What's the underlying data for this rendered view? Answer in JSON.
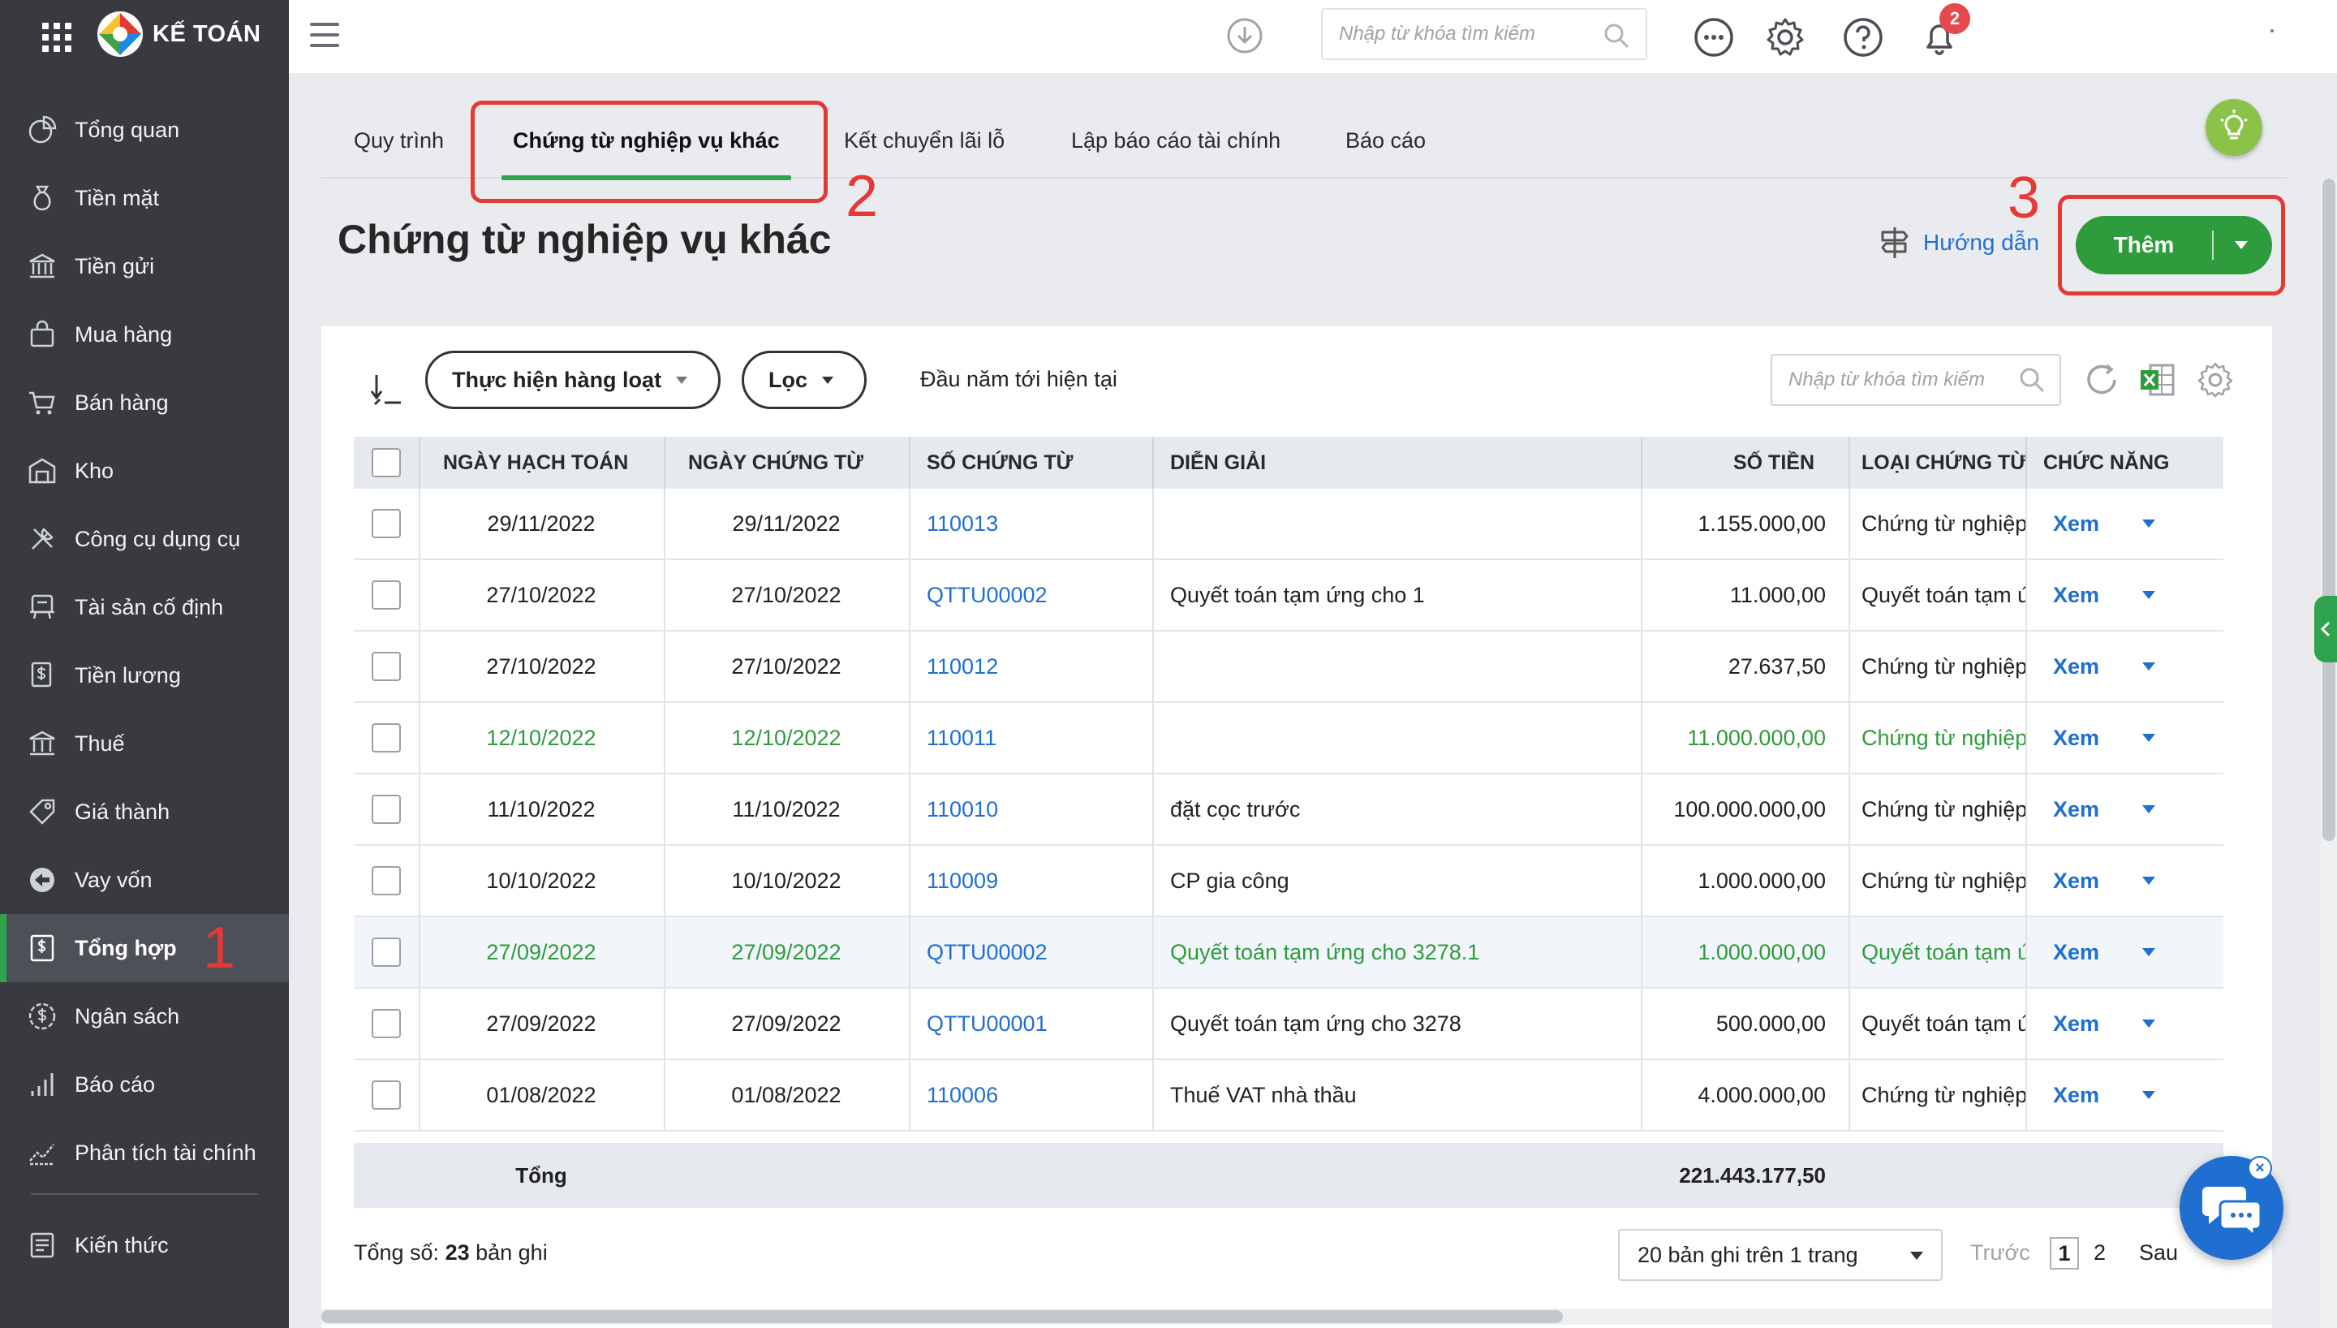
{
  "app": {
    "name": "KẾ TOÁN"
  },
  "sidebar": {
    "items": [
      {
        "label": "Tổng quan",
        "icon": "chart-pie-icon"
      },
      {
        "label": "Tiền mặt",
        "icon": "money-bag-icon"
      },
      {
        "label": "Tiền gửi",
        "icon": "bank-icon"
      },
      {
        "label": "Mua hàng",
        "icon": "shopping-bag-icon"
      },
      {
        "label": "Bán hàng",
        "icon": "cart-icon"
      },
      {
        "label": "Kho",
        "icon": "warehouse-icon"
      },
      {
        "label": "Công cụ dụng cụ",
        "icon": "tools-icon"
      },
      {
        "label": "Tài sản cố định",
        "icon": "asset-icon"
      },
      {
        "label": "Tiền lương",
        "icon": "payroll-icon"
      },
      {
        "label": "Thuế",
        "icon": "tax-icon"
      },
      {
        "label": "Giá thành",
        "icon": "price-tag-icon"
      },
      {
        "label": "Vay vốn",
        "icon": "loan-icon"
      },
      {
        "label": "Tổng hợp",
        "icon": "ledger-icon",
        "active": true
      },
      {
        "label": "Ngân sách",
        "icon": "budget-icon"
      },
      {
        "label": "Báo cáo",
        "icon": "bar-chart-icon"
      },
      {
        "label": "Phân tích tài chính",
        "icon": "trend-icon"
      }
    ],
    "footer_item": {
      "label": "Kiến thức",
      "icon": "book-icon"
    }
  },
  "topbar": {
    "search_placeholder": "Nhập từ khóa tìm kiếm",
    "notification_count": "2"
  },
  "tabs": [
    {
      "label": "Quy trình"
    },
    {
      "label": "Chứng từ nghiệp vụ khác",
      "active": true
    },
    {
      "label": "Kết chuyển lãi lỗ"
    },
    {
      "label": "Lập báo cáo tài chính"
    },
    {
      "label": "Báo cáo"
    }
  ],
  "annotations": {
    "step1": "1",
    "step2": "2",
    "step3": "3"
  },
  "page": {
    "title": "Chứng từ nghiệp vụ khác",
    "guide_label": "Hướng dẫn",
    "add_label": "Thêm"
  },
  "toolbar": {
    "bulk_label": "Thực hiện hàng loạt",
    "filter_label": "Lọc",
    "period_label": "Đầu năm tới hiện tại",
    "search_placeholder": "Nhập từ khóa tìm kiếm"
  },
  "table": {
    "headers": {
      "posting_date": "NGÀY HẠCH TOÁN",
      "doc_date": "NGÀY CHỨNG TỪ",
      "doc_no": "SỐ CHỨNG TỪ",
      "description": "DIỄN GIẢI",
      "amount": "SỐ TIỀN",
      "doc_type": "LOẠI CHỨNG TỪ",
      "actions": "CHỨC NĂNG"
    },
    "rows": [
      {
        "posting_date": "29/11/2022",
        "doc_date": "29/11/2022",
        "doc_no": "110013",
        "description": "",
        "amount": "1.155.000,00",
        "doc_type": "Chứng từ nghiệp vụ khác",
        "action": "Xem"
      },
      {
        "posting_date": "27/10/2022",
        "doc_date": "27/10/2022",
        "doc_no": "QTTU00002",
        "description": "Quyết toán tạm ứng cho 1",
        "amount": "11.000,00",
        "doc_type": "Quyết toán tạm ứng",
        "action": "Xem"
      },
      {
        "posting_date": "27/10/2022",
        "doc_date": "27/10/2022",
        "doc_no": "110012",
        "description": "",
        "amount": "27.637,50",
        "doc_type": "Chứng từ nghiệp vụ khác",
        "action": "Xem"
      },
      {
        "posting_date": "12/10/2022",
        "doc_date": "12/10/2022",
        "doc_no": "110011",
        "description": "",
        "amount": "11.000.000,00",
        "doc_type": "Chứng từ nghiệp vụ khác",
        "action": "Xem",
        "highlight": "green"
      },
      {
        "posting_date": "11/10/2022",
        "doc_date": "11/10/2022",
        "doc_no": "110010",
        "description": "đặt cọc trước",
        "amount": "100.000.000,00",
        "doc_type": "Chứng từ nghiệp vụ khác",
        "action": "Xem"
      },
      {
        "posting_date": "10/10/2022",
        "doc_date": "10/10/2022",
        "doc_no": "110009",
        "description": "CP gia công",
        "amount": "1.000.000,00",
        "doc_type": "Chứng từ nghiệp vụ khác",
        "action": "Xem"
      },
      {
        "posting_date": "27/09/2022",
        "doc_date": "27/09/2022",
        "doc_no": "QTTU00002",
        "description": "Quyết toán tạm ứng cho 3278.1",
        "amount": "1.000.000,00",
        "doc_type": "Quyết toán tạm ứng",
        "action": "Xem",
        "highlight": "green",
        "selected": true
      },
      {
        "posting_date": "27/09/2022",
        "doc_date": "27/09/2022",
        "doc_no": "QTTU00001",
        "description": "Quyết toán tạm ứng cho 3278",
        "amount": "500.000,00",
        "doc_type": "Quyết toán tạm ứng",
        "action": "Xem"
      },
      {
        "posting_date": "01/08/2022",
        "doc_date": "01/08/2022",
        "doc_no": "110006",
        "description": "Thuế VAT nhà thầu",
        "amount": "4.000.000,00",
        "doc_type": "Chứng từ nghiệp vụ khác",
        "action": "Xem"
      }
    ],
    "footer": {
      "label": "Tổng",
      "total": "221.443.177,50"
    }
  },
  "pager": {
    "total_prefix": "Tổng số: ",
    "total_count": "23",
    "total_suffix": " bản ghi",
    "page_size_label": "20 bản ghi trên 1 trang",
    "prev_label": "Trước",
    "pages": [
      "1",
      "2"
    ],
    "next_label": "Sau"
  },
  "colors": {
    "sidebar_bg": "#383a3f",
    "accent_green": "#2e9b3c",
    "link_blue": "#1f6fd1",
    "annotation_red": "#e53935"
  }
}
